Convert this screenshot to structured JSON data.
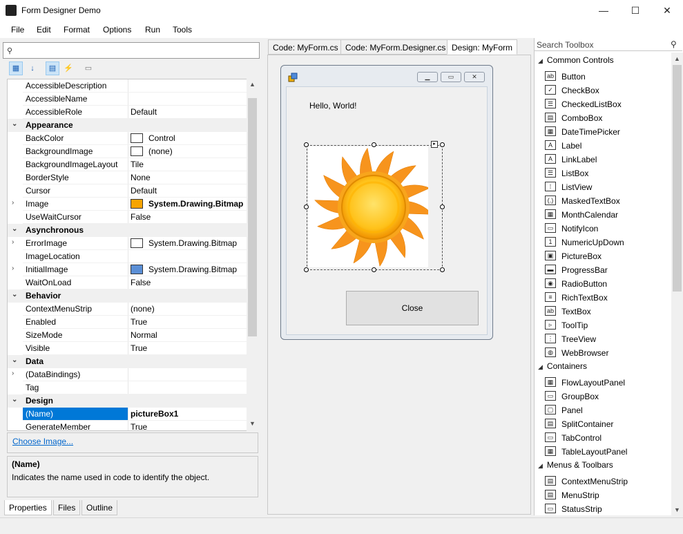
{
  "window": {
    "title": "Form Designer Demo",
    "minimize": "—",
    "maximize": "☐",
    "close": "✕"
  },
  "menu": [
    "File",
    "Edit",
    "Format",
    "Options",
    "Run",
    "Tools"
  ],
  "properties": {
    "search_icon": "⚲",
    "rows": [
      {
        "type": "prop",
        "name": "AccessibleDescription",
        "value": ""
      },
      {
        "type": "prop",
        "name": "AccessibleName",
        "value": ""
      },
      {
        "type": "prop",
        "name": "AccessibleRole",
        "value": "Default"
      },
      {
        "type": "cat",
        "name": "Appearance"
      },
      {
        "type": "prop",
        "name": "BackColor",
        "value": "Control",
        "swatch": "#ffffff"
      },
      {
        "type": "prop",
        "name": "BackgroundImage",
        "value": "(none)",
        "swatch": "#ffffff"
      },
      {
        "type": "prop",
        "name": "BackgroundImageLayout",
        "value": "Tile"
      },
      {
        "type": "prop",
        "name": "BorderStyle",
        "value": "None"
      },
      {
        "type": "prop",
        "name": "Cursor",
        "value": "Default"
      },
      {
        "type": "prop",
        "name": "Image",
        "value": "System.Drawing.Bitmap",
        "swatch": "#f7a400",
        "expand": true,
        "bold": true
      },
      {
        "type": "prop",
        "name": "UseWaitCursor",
        "value": "False"
      },
      {
        "type": "cat",
        "name": "Asynchronous"
      },
      {
        "type": "prop",
        "name": "ErrorImage",
        "value": "System.Drawing.Bitmap",
        "swatch": "#ffffff",
        "expand": true
      },
      {
        "type": "prop",
        "name": "ImageLocation",
        "value": ""
      },
      {
        "type": "prop",
        "name": "InitialImage",
        "value": "System.Drawing.Bitmap",
        "swatch": "#5b8fd6",
        "expand": true
      },
      {
        "type": "prop",
        "name": "WaitOnLoad",
        "value": "False"
      },
      {
        "type": "cat",
        "name": "Behavior"
      },
      {
        "type": "prop",
        "name": "ContextMenuStrip",
        "value": "(none)"
      },
      {
        "type": "prop",
        "name": "Enabled",
        "value": "True"
      },
      {
        "type": "prop",
        "name": "SizeMode",
        "value": "Normal"
      },
      {
        "type": "prop",
        "name": "Visible",
        "value": "True"
      },
      {
        "type": "cat",
        "name": "Data"
      },
      {
        "type": "prop",
        "name": "(DataBindings)",
        "value": "",
        "expand": true
      },
      {
        "type": "prop",
        "name": "Tag",
        "value": ""
      },
      {
        "type": "cat",
        "name": "Design"
      },
      {
        "type": "prop",
        "name": "(Name)",
        "value": "pictureBox1",
        "selected": true,
        "bold": true
      },
      {
        "type": "prop",
        "name": "GenerateMember",
        "value": "True"
      }
    ],
    "choose_image": "Choose Image...",
    "desc_title": "(Name)",
    "desc_text": "Indicates the name used in code to identify the object.",
    "bottom_tabs": [
      "Properties",
      "Files",
      "Outline"
    ]
  },
  "editor_tabs": [
    "Code: MyForm.cs",
    "Code: MyForm.Designer.cs",
    "Design: MyForm"
  ],
  "form": {
    "label": "Hello, World!",
    "close_button": "Close"
  },
  "toolbox": {
    "search_placeholder": "Search Toolbox",
    "groups": [
      {
        "name": "Common Controls",
        "items": [
          {
            "label": "Button",
            "icon": "ab"
          },
          {
            "label": "CheckBox",
            "icon": "✓"
          },
          {
            "label": "CheckedListBox",
            "icon": "☰"
          },
          {
            "label": "ComboBox",
            "icon": "▤"
          },
          {
            "label": "DateTimePicker",
            "icon": "▦"
          },
          {
            "label": "Label",
            "icon": "A"
          },
          {
            "label": "LinkLabel",
            "icon": "A"
          },
          {
            "label": "ListBox",
            "icon": "☰"
          },
          {
            "label": "ListView",
            "icon": "⁞"
          },
          {
            "label": "MaskedTextBox",
            "icon": "(.)"
          },
          {
            "label": "MonthCalendar",
            "icon": "▦"
          },
          {
            "label": "NotifyIcon",
            "icon": "▭"
          },
          {
            "label": "NumericUpDown",
            "icon": "1"
          },
          {
            "label": "PictureBox",
            "icon": "▣"
          },
          {
            "label": "ProgressBar",
            "icon": "▬"
          },
          {
            "label": "RadioButton",
            "icon": "◉"
          },
          {
            "label": "RichTextBox",
            "icon": "≡"
          },
          {
            "label": "TextBox",
            "icon": "ab"
          },
          {
            "label": "ToolTip",
            "icon": "▹"
          },
          {
            "label": "TreeView",
            "icon": "⋮"
          },
          {
            "label": "WebBrowser",
            "icon": "◍"
          }
        ]
      },
      {
        "name": "Containers",
        "items": [
          {
            "label": "FlowLayoutPanel",
            "icon": "▦"
          },
          {
            "label": "GroupBox",
            "icon": "▭"
          },
          {
            "label": "Panel",
            "icon": "▢"
          },
          {
            "label": "SplitContainer",
            "icon": "▤"
          },
          {
            "label": "TabControl",
            "icon": "▭"
          },
          {
            "label": "TableLayoutPanel",
            "icon": "▦"
          }
        ]
      },
      {
        "name": "Menus & Toolbars",
        "items": [
          {
            "label": "ContextMenuStrip",
            "icon": "▤"
          },
          {
            "label": "MenuStrip",
            "icon": "▤"
          },
          {
            "label": "StatusStrip",
            "icon": "▭"
          }
        ]
      }
    ]
  }
}
